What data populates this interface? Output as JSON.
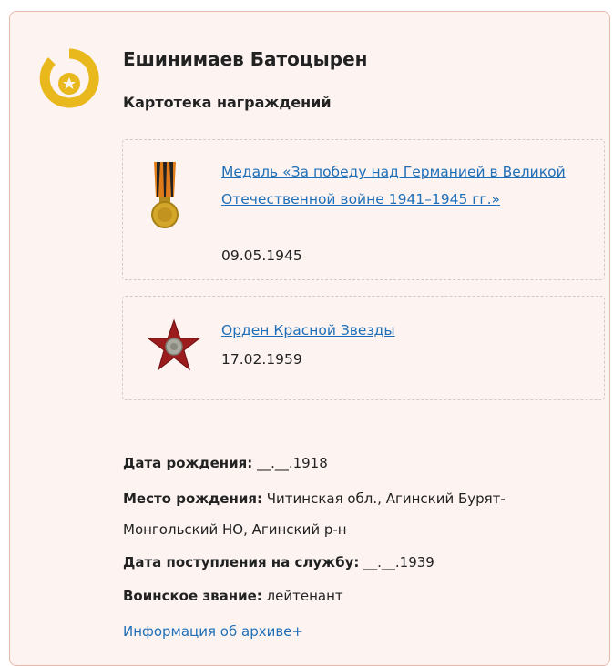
{
  "person": {
    "name": "Ешинимаев Батоцырен",
    "icon": "medal-badge-icon"
  },
  "awards_section": {
    "title": "Картотека награждений",
    "items": [
      {
        "link": "Медаль «За победу над Германией в Великой Отечественной войне 1941–1945 гг.»",
        "date": "09.05.1945",
        "icon": "victory-medal-icon"
      },
      {
        "link": "Орден Красной Звезды",
        "date": "17.02.1959",
        "icon": "red-star-order-icon"
      }
    ]
  },
  "details": {
    "birthdate_label": "Дата рождения:",
    "birthdate_value": "__.__.1918",
    "birthplace_label": "Место рождения:",
    "birthplace_value_1": "Читинская обл., Агинский Бурят-",
    "birthplace_value_2": "Монгольский НО, Агинский р-н",
    "service_label": "Дата поступления на службу:",
    "service_value": "__.__.1939",
    "rank_label": "Воинское звание:",
    "rank_value": "лейтенант"
  },
  "archive_link": "Информация об архиве+",
  "colors": {
    "accent_link": "#1f6fb8",
    "badge_gold": "#e8b81c",
    "card_bg": "#fdf4f2",
    "card_border": "#e8b8ab"
  }
}
